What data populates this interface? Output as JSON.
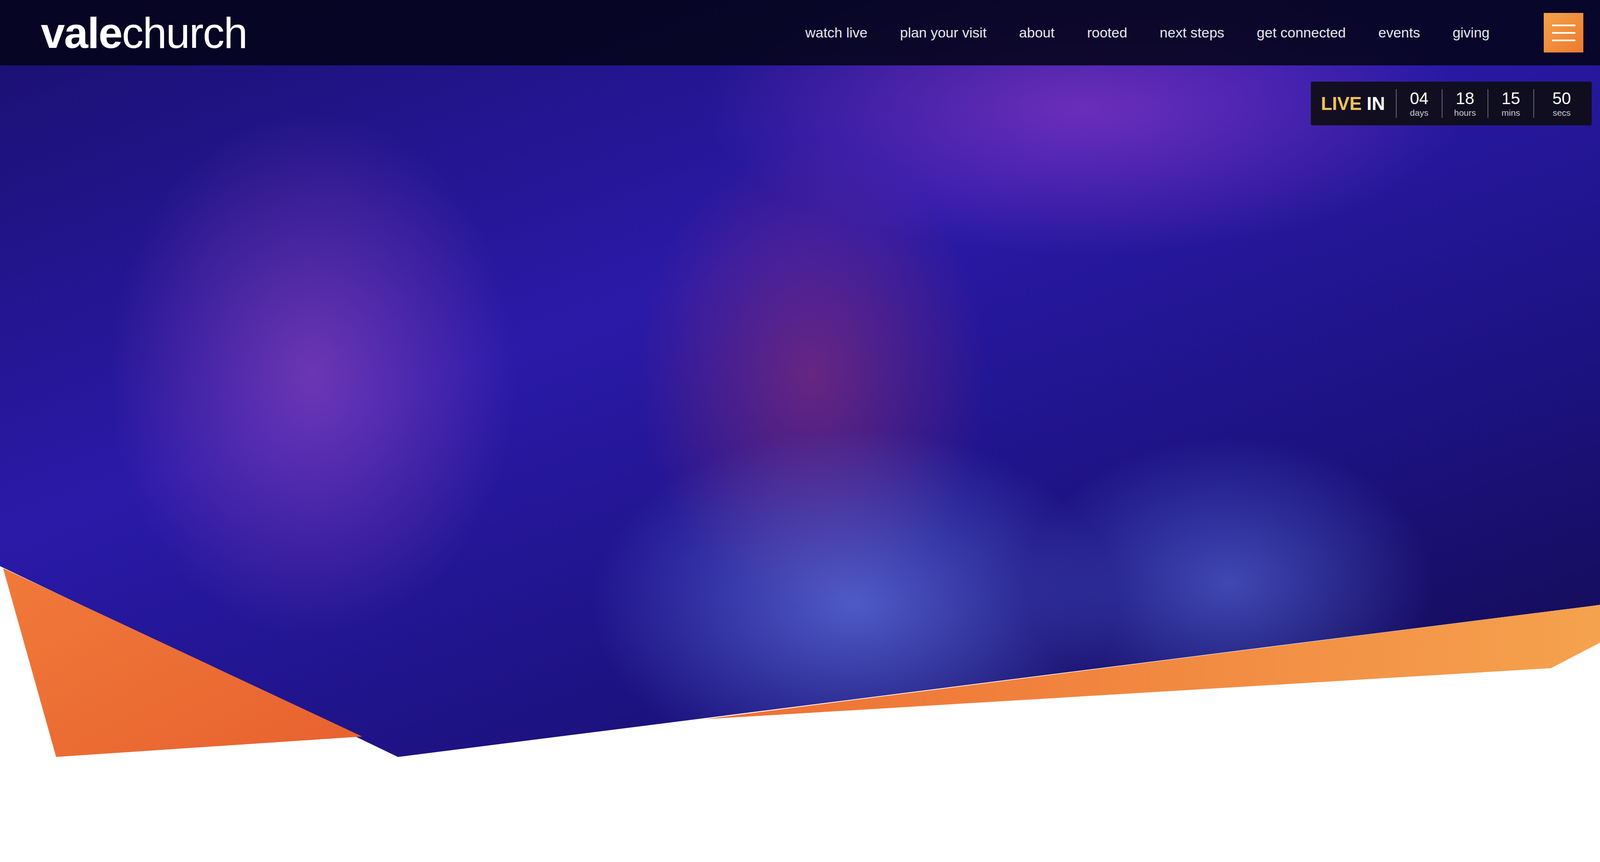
{
  "header": {
    "logo": {
      "bold": "vale",
      "light": "church"
    },
    "nav": [
      {
        "label": "watch live"
      },
      {
        "label": "plan your visit"
      },
      {
        "label": "about"
      },
      {
        "label": "rooted"
      },
      {
        "label": "next steps"
      },
      {
        "label": "get connected"
      },
      {
        "label": "events"
      },
      {
        "label": "giving"
      }
    ]
  },
  "countdown": {
    "highlight": "LIVE",
    "label": "IN",
    "units": [
      {
        "value": "04",
        "label": "days"
      },
      {
        "value": "18",
        "label": "hours"
      },
      {
        "value": "15",
        "label": "mins"
      },
      {
        "value": "50",
        "label": "secs"
      }
    ]
  }
}
